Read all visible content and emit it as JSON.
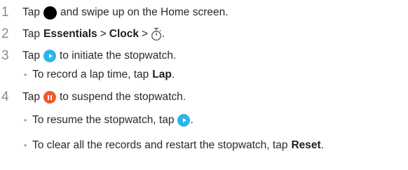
{
  "steps": [
    {
      "number": "1",
      "before": "Tap",
      "after": "and swipe up on the Home screen."
    },
    {
      "number": "2",
      "before": "Tap",
      "bold1": "Essentials",
      "sep1": ">",
      "bold2": "Clock",
      "sep2": ">",
      "end": "."
    },
    {
      "number": "3",
      "before": "Tap",
      "after": "to initiate the stopwatch.",
      "sub": {
        "bullet": "•",
        "before": "To record a lap time, tap",
        "bold": "Lap",
        "end": "."
      }
    },
    {
      "number": "4",
      "before": "Tap",
      "after": "to suspend the stopwatch.",
      "subs": [
        {
          "bullet": "•",
          "before": "To resume the stopwatch, tap",
          "end": "."
        },
        {
          "bullet": "•",
          "before": "To clear all the records and restart the stopwatch, tap",
          "bold": "Reset",
          "end": "."
        }
      ]
    }
  ],
  "icons": {
    "home": "home-button-icon",
    "stopwatch": "stopwatch-icon",
    "start": "play-icon",
    "pause": "pause-icon",
    "colors": {
      "home": "#000000",
      "play": "#2bb5e8",
      "pause": "#ef5b2c"
    }
  }
}
